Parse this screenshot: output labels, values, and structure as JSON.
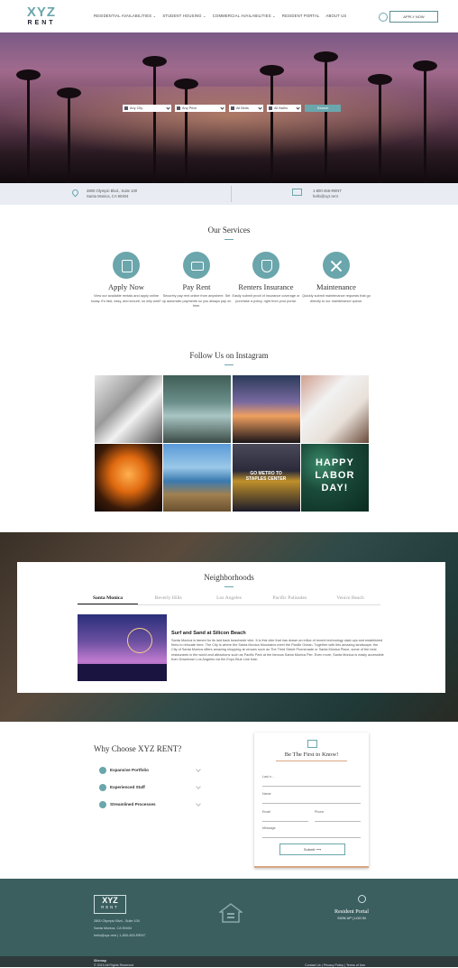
{
  "brand": {
    "logo_top": "XYZ",
    "logo_bottom": "RENT",
    "accent": "#6aa6ac"
  },
  "nav": {
    "items": [
      "RESIDENTIAL AVAILABILITIES ⌄",
      "STUDENT HOUSING ⌄",
      "COMMERCIAL AVAILABILITIES ⌄",
      "RESIDENT PORTAL",
      "ABOUT US"
    ],
    "apply_label": "APPLY NOW"
  },
  "search": {
    "city": "Any City",
    "price": "Any Price",
    "beds": "All Beds",
    "baths": "All Baths",
    "button": "Search"
  },
  "contact": {
    "address1": "2800 Olympic Blvd., Suite 100",
    "address2": "Santa Monica, CA 90404",
    "phone": "1-800-456-RENT",
    "email": "hello@xyz.rent"
  },
  "services": {
    "heading": "Our Services",
    "items": [
      {
        "title": "Apply Now",
        "desc": "View our available rentals and apply online today. It's fast, easy, and secure, so why wait?",
        "icon": "application-icon"
      },
      {
        "title": "Pay Rent",
        "desc": "Securely pay rent online from anywhere. Set up automatic payments so you always pay on time.",
        "icon": "credit-card-icon"
      },
      {
        "title": "Renters Insurance",
        "desc": "Easily submit proof of insurance coverage or purchase a policy, right from your portal.",
        "icon": "shield-icon"
      },
      {
        "title": "Maintenance",
        "desc": "Quickly submit maintenance requests that go directly to our maintenance queue.",
        "icon": "tools-icon"
      }
    ]
  },
  "instagram": {
    "heading": "Follow Us on Instagram",
    "labor_text": "HAPPY LABOR DAY!",
    "metro_text": "GO METRO TO STAPLES CENTER"
  },
  "neighborhoods": {
    "heading": "Neighborhoods",
    "tabs": [
      "Santa Monica",
      "Beverly Hills",
      "Los Angeles",
      "Pacific Palisades",
      "Venice Beach"
    ],
    "active_title": "Surf and Sand at Silicon Beach",
    "active_text": "Santa Monica is famed for its laid back beachside vibe. It is this vibe that has drawn an influx of recent technology start-ups and established firms to relocate here. The City is where the Santa Monica Mountains meet the Pacific Ocean. Together with this amazing landscape, the City of Santa Monica offers amazing shopping at venues such as The Third Street Promenade or Santa Monica Place, some of the best restaurants in the world and attractions such as Pacific Park at the famous Santa Monica Pier. Even more, Santa Monica is easily accessible from Downtown Los Angeles via the Expo Blue Line train."
  },
  "why": {
    "heading": "Why Choose XYZ RENT?",
    "items": [
      "Expansive Portfolio",
      "Experienced Staff",
      "Streamlined Processes"
    ]
  },
  "form": {
    "title": "Be The First to Know!",
    "fields": {
      "last": "Last n...",
      "name": "Name",
      "email": "Email",
      "phone": "Phone",
      "message": "Message"
    },
    "submit": "Submit  ⟶"
  },
  "footer": {
    "logo_top": "XYZ",
    "logo_bottom": "RENT",
    "address1": "2800 Olympic Blvd., Suite 100",
    "address2": "Santa Monica, CA 90404",
    "contact": "hello@xyz.rent  |  1-800-453-RENT",
    "portal_title": "Resident Portal",
    "portal_links": "SIGN UP  |  LOG IN",
    "sitemap": "Sitemap",
    "copyright": "© 2019 All Rights Reserved",
    "legal": "Contact Us  |  Privacy Policy  |  Terms of Use"
  }
}
